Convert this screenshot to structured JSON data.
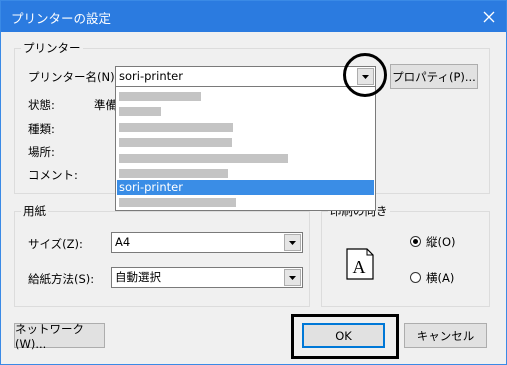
{
  "window": {
    "title": "プリンターの設定",
    "close_icon": "close-icon"
  },
  "printer_group": {
    "label": "プリンター",
    "name_label": "プリンター名(N):",
    "name_value": "sori-printer",
    "properties_button": "プロパティ(P)...",
    "status_label": "状態:",
    "status_value": "準備",
    "type_label": "種類:",
    "location_label": "場所:",
    "comment_label": "コメント:",
    "dropdown_items": [
      {
        "selected": false
      },
      {
        "selected": false
      },
      {
        "selected": false
      },
      {
        "selected": false
      },
      {
        "selected": false
      },
      {
        "selected": false
      },
      {
        "label": "sori-printer",
        "selected": true
      },
      {
        "selected": false
      }
    ]
  },
  "paper_group": {
    "label": "用紙",
    "size_label": "サイズ(Z):",
    "size_value": "A4",
    "source_label": "給紙方法(S):",
    "source_value": "自動選択"
  },
  "orientation_group": {
    "label": "印刷の向き",
    "portrait_label": "縦(O)",
    "landscape_label": "横(A)",
    "selected": "portrait",
    "preview_letter": "A"
  },
  "buttons": {
    "network": "ネットワーク(W)...",
    "ok": "OK",
    "cancel": "キャンセル"
  },
  "colors": {
    "titlebar": "#2b7be0",
    "selection": "#3a8de6"
  }
}
